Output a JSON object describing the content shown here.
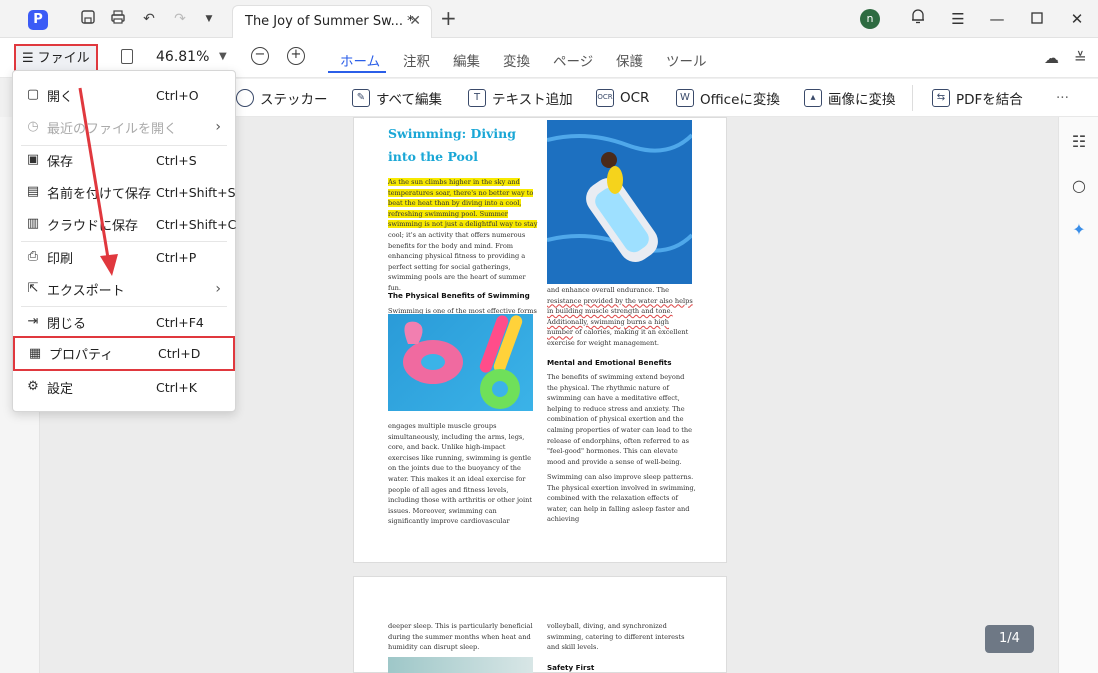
{
  "titlebar": {
    "logo": "P",
    "tab_title": "The Joy of Summer Sw... *",
    "tab_close": "✕",
    "new_tab": "+",
    "avatar_letter": "n",
    "icons": [
      "save-icon",
      "print-icon",
      "undo-icon",
      "redo-icon",
      "dropdown-icon",
      "bell-icon",
      "menu-icon",
      "minimize-icon",
      "maximize-icon",
      "close-icon"
    ]
  },
  "toolbar": {
    "file_label": "ファイル",
    "zoom_value": "46.81%",
    "tabs": [
      "ホーム",
      "注釈",
      "編集",
      "変換",
      "ページ",
      "保護",
      "ツール"
    ],
    "active_tab": "ホーム"
  },
  "ribbon": {
    "items": [
      "ステッカー",
      "すべて編集",
      "テキスト追加",
      "OCR",
      "Officeに変換",
      "画像に変換",
      "PDFを結合"
    ],
    "more": "···"
  },
  "file_menu": {
    "items": [
      {
        "label": "開く",
        "shortcut": "Ctrl+O",
        "icon": "open-icon"
      },
      {
        "label": "最近のファイルを開く",
        "shortcut": "",
        "icon": "clock-icon",
        "disabled": true,
        "submenu": true
      },
      {
        "label": "保存",
        "shortcut": "Ctrl+S",
        "icon": "save-icon"
      },
      {
        "label": "名前を付けて保存",
        "shortcut": "Ctrl+Shift+S",
        "icon": "save-as-icon"
      },
      {
        "label": "クラウドに保存",
        "shortcut": "Ctrl+Shift+C",
        "icon": "cloud-save-icon"
      },
      {
        "label": "印刷",
        "shortcut": "Ctrl+P",
        "icon": "print-icon"
      },
      {
        "label": "エクスポート",
        "shortcut": "",
        "icon": "export-icon",
        "submenu": true
      },
      {
        "label": "閉じる",
        "shortcut": "Ctrl+F4",
        "icon": "close-doc-icon"
      },
      {
        "label": "プロパティ",
        "shortcut": "Ctrl+D",
        "icon": "properties-icon",
        "highlighted": true
      },
      {
        "label": "設定",
        "shortcut": "Ctrl+K",
        "icon": "settings-icon"
      }
    ]
  },
  "page1": {
    "title": "Swimming: Diving into the Pool",
    "intro_highlight": "As the sun climbs higher in the sky and temperatures soar, there's no better way to beat the heat than by diving into a cool, refreshing swimming pool. Summer swimming is not just a delightful way to stay",
    "intro_rest": "cool; it's an activity that offers numerous benefits for the body and mind. From enhancing physical fitness to providing a perfect setting for social gatherings, swimming pools are the heart of summer fun.",
    "h_physical": "The Physical Benefits of Swimming",
    "physical_text": "Swimming is one of the most effective forms of exercise. It's a full-body workout that",
    "physical_cont": "engages multiple muscle groups simultaneously, including the arms, legs, core, and back. Unlike high-impact exercises like running, swimming is gentle on the joints due to the buoyancy of the water. This makes it an ideal exercise for people of all ages and fitness levels, including those with arthritis or other joint issues. Moreover, swimming can significantly improve cardiovascular",
    "right_top_plain": "and enhance overall endurance. The",
    "right_top_underlined": "resistance provided by the water also helps in building muscle strength and tone. Additionally, swimming burns a high number",
    "right_top_rest": "of calories, making it an excellent exercise for weight management.",
    "h_mental": "Mental and Emotional Benefits",
    "mental_text": "The benefits of swimming extend beyond the physical. The rhythmic nature of swimming can have a meditative effect, helping to reduce stress and anxiety. The combination of physical exertion and the calming properties of water can lead to the release of endorphins, often referred to as \"feel-good\" hormones. This can elevate mood and provide a sense of well-being.",
    "sleep_text": "Swimming can also improve sleep patterns. The physical exertion involved in swimming, combined with the relaxation effects of water, can help in falling asleep faster and achieving"
  },
  "page2": {
    "left_text": "deeper sleep. This is particularly beneficial during the summer months when heat and humidity can disrupt sleep.",
    "right_text": "volleyball, diving, and synchronized swimming, catering to different interests and skill levels.",
    "h_safety": "Safety First"
  },
  "page_indicator": "1/4"
}
